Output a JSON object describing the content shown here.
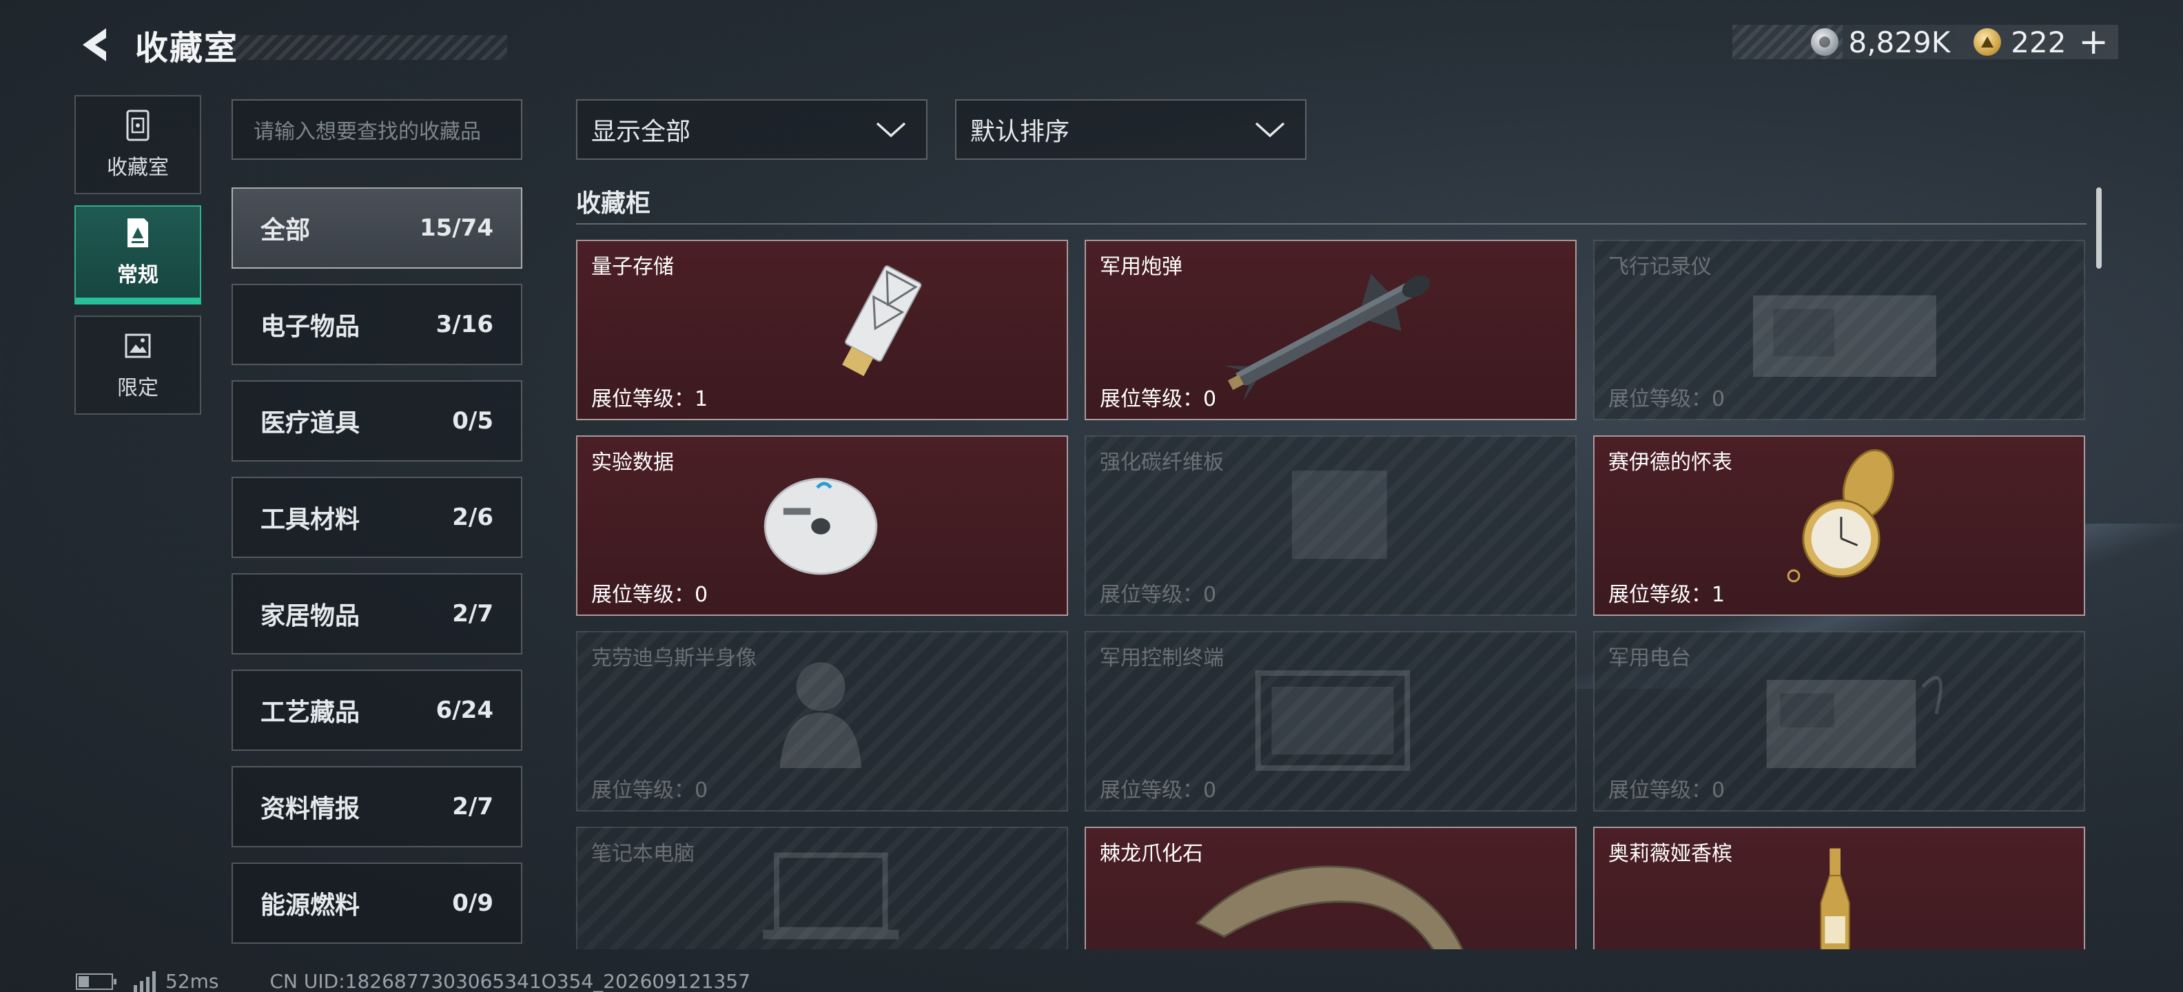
{
  "header": {
    "title": "收藏室",
    "back_icon": "back-arrow-icon"
  },
  "currency": {
    "silver_value": "8,829K",
    "gold_value": "222",
    "plus_label": "+"
  },
  "leftnav": [
    {
      "label": "收藏室",
      "icon": "locker-icon",
      "active": false
    },
    {
      "label": "常规",
      "icon": "card-icon",
      "active": true
    },
    {
      "label": "限定",
      "icon": "picture-icon",
      "active": false
    }
  ],
  "search": {
    "placeholder": "请输入想要查找的收藏品"
  },
  "categories": [
    {
      "name": "全部",
      "count": "15/74",
      "active": true
    },
    {
      "name": "电子物品",
      "count": "3/16"
    },
    {
      "name": "医疗道具",
      "count": "0/5"
    },
    {
      "name": "工具材料",
      "count": "2/6"
    },
    {
      "name": "家居物品",
      "count": "2/7"
    },
    {
      "name": "工艺藏品",
      "count": "6/24"
    },
    {
      "name": "资料情报",
      "count": "2/7"
    },
    {
      "name": "能源燃料",
      "count": "0/9"
    }
  ],
  "filters": {
    "show_label": "显示全部",
    "sort_label": "默认排序"
  },
  "section": {
    "title": "收藏柜"
  },
  "items": [
    {
      "name": "量子存储",
      "level": "展位等级：1",
      "owned": true,
      "art": "usb-drive"
    },
    {
      "name": "军用炮弹",
      "level": "展位等级：0",
      "owned": true,
      "art": "missile"
    },
    {
      "name": "飞行记录仪",
      "level": "展位等级：0",
      "owned": false,
      "art": "box"
    },
    {
      "name": "实验数据",
      "level": "展位等级：0",
      "owned": true,
      "art": "disc"
    },
    {
      "name": "强化碳纤维板",
      "level": "展位等级：0",
      "owned": false,
      "art": "panel"
    },
    {
      "name": "赛伊德的怀表",
      "level": "展位等级：1",
      "owned": true,
      "art": "pocket-watch"
    },
    {
      "name": "克劳迪乌斯半身像",
      "level": "展位等级：0",
      "owned": false,
      "art": "bust"
    },
    {
      "name": "军用控制终端",
      "level": "展位等级：0",
      "owned": false,
      "art": "terminal"
    },
    {
      "name": "军用电台",
      "level": "展位等级：0",
      "owned": false,
      "art": "radio"
    },
    {
      "name": "笔记本电脑",
      "level": "",
      "owned": false,
      "art": "laptop"
    },
    {
      "name": "棘龙爪化石",
      "level": "",
      "owned": true,
      "art": "claw-fossil"
    },
    {
      "name": "奥莉薇娅香槟",
      "level": "",
      "owned": true,
      "art": "champagne"
    }
  ],
  "footer": {
    "ping": "52ms",
    "uid": "CN UID:1826877303065341O354_202609121357"
  }
}
